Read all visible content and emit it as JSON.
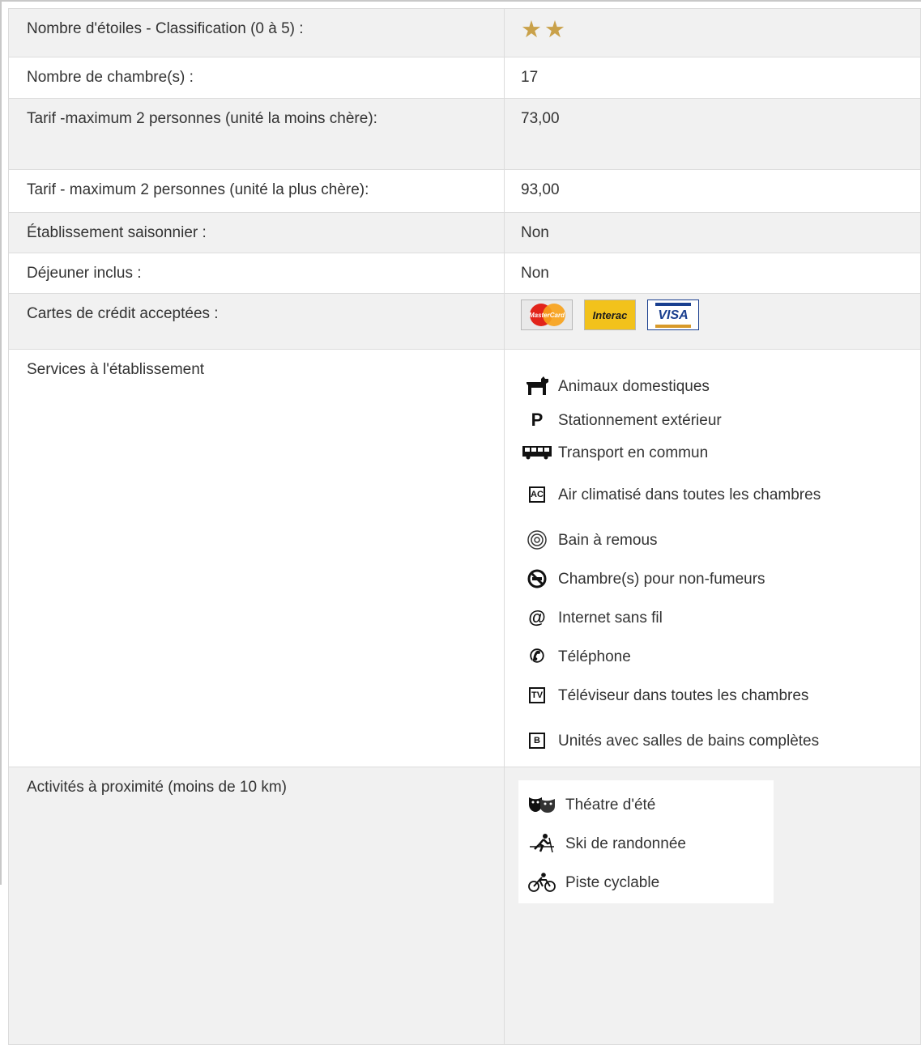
{
  "rows": [
    {
      "label": "Nombre d'étoiles - Classification (0 à 5) :",
      "stars": 2
    },
    {
      "label": "Nombre de chambre(s) :",
      "value": "17"
    },
    {
      "label": "Tarif -maximum 2 personnes (unité la moins chère):",
      "value": "73,00"
    },
    {
      "label": "Tarif - maximum 2 personnes (unité la plus chère):",
      "value": "93,00"
    },
    {
      "label": "Établissement saisonnier :",
      "value": "Non"
    },
    {
      "label": "Déjeuner inclus :",
      "value": "Non"
    },
    {
      "label": "Cartes de crédit acceptées :"
    },
    {
      "label": "Services à l'établissement"
    },
    {
      "label": "Activités à proximité (moins de 10 km)"
    }
  ],
  "stars": {
    "symbol": "★",
    "color": "#c9a14a"
  },
  "cards": [
    {
      "name": "mastercard",
      "text": "MasterCard"
    },
    {
      "name": "interac",
      "text": "Interac"
    },
    {
      "name": "visa",
      "text": "VISA"
    }
  ],
  "services": [
    {
      "icon": "dog-icon",
      "glyph": "",
      "label": "Animaux domestiques"
    },
    {
      "icon": "parking-icon",
      "glyph": "P",
      "label": "Stationnement extérieur"
    },
    {
      "icon": "bus-icon",
      "glyph": "",
      "label": "Transport en commun"
    },
    {
      "icon": "air-conditioning-icon",
      "glyph": "AC",
      "label": "Air climatisé dans toutes les chambres"
    },
    {
      "icon": "whirlpool-icon",
      "glyph": "",
      "label": "Bain à remous"
    },
    {
      "icon": "no-smoking-icon",
      "glyph": "",
      "label": "Chambre(s) pour non-fumeurs"
    },
    {
      "icon": "at-sign-icon",
      "glyph": "@",
      "label": "Internet sans fil"
    },
    {
      "icon": "telephone-icon",
      "glyph": "✆",
      "label": "Téléphone"
    },
    {
      "icon": "tv-icon",
      "glyph": "TV",
      "label": "Téléviseur dans toutes les chambres"
    },
    {
      "icon": "bathroom-icon",
      "glyph": "B",
      "label": "Unités avec salles de bains complètes"
    }
  ],
  "activities": [
    {
      "icon": "theatre-masks-icon",
      "label": "Théatre d'été"
    },
    {
      "icon": "cross-country-ski-icon",
      "label": "Ski de randonnée"
    },
    {
      "icon": "bicycle-icon",
      "label": "Piste cyclable"
    }
  ]
}
